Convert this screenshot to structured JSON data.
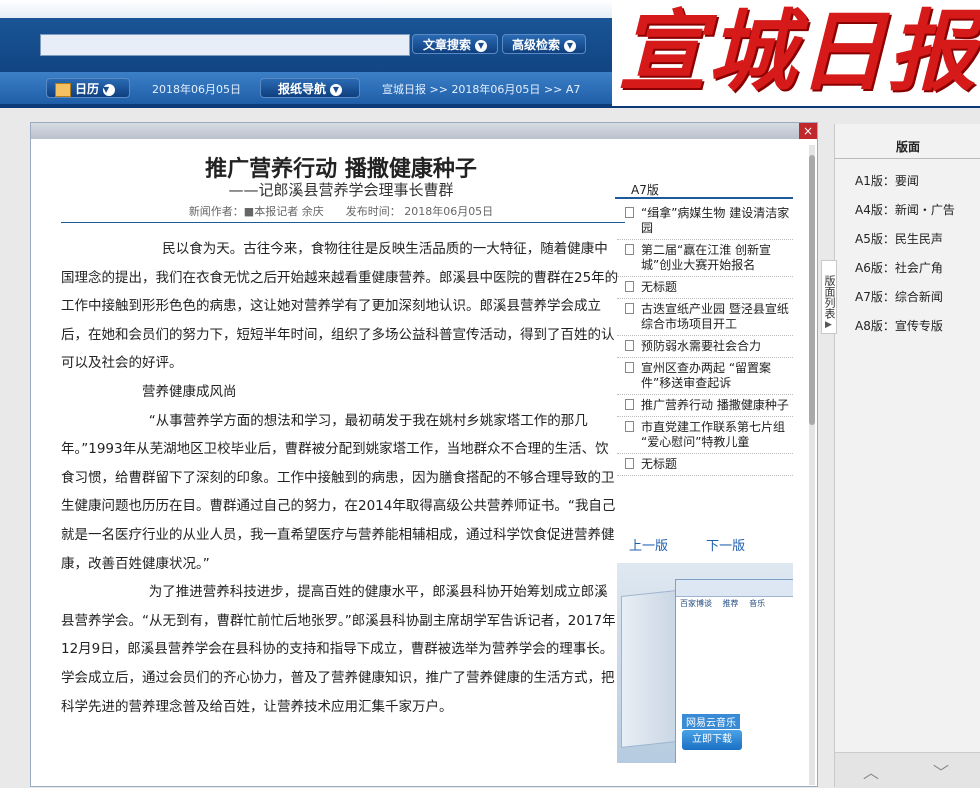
{
  "header": {
    "search_placeholder": "",
    "article_search": "文章搜索",
    "advanced_search": "高级检索",
    "logo_text": "宣城日报"
  },
  "nav": {
    "calendar": "日历",
    "date": "2018年06月05日",
    "paper_nav": "报纸导航",
    "breadcrumb": [
      "宣城日报",
      "2018年06月05日",
      "A7"
    ],
    "breadcrumb_sep": ">>"
  },
  "article": {
    "title": "推广营养行动 播撒健康种子",
    "subtitle": "——记郎溪县营养学会理事长曹群",
    "meta": "新闻作者：■本报记者 余庆　　发布时间： 2018年06月05日",
    "paragraphs": [
      "民以食为天。古往今来，食物往往是反映生活品质的一大特征，随着健康中国理念的提出，我们在衣食无忧之后开始越来越看重健康营养。郎溪县中医院的曹群在25年的工作中接触到形形色色的病患，这让她对营养学有了更加深刻地认识。郎溪县营养学会成立后，在她和会员们的努力下，短短半年时间，组织了多场公益科普宣传活动，得到了百姓的认可以及社会的好评。",
      "营养健康成风尚",
      "“从事营养学方面的想法和学习，最初萌发于我在姚村乡姚家塔工作的那几年。”1993年从芜湖地区卫校毕业后，曹群被分配到姚家塔工作，当地群众不合理的生活、饮食习惯，给曹群留下了深刻的印象。工作中接触到的病患，因为膳食搭配的不够合理导致的卫生健康问题也历历在目。曹群通过自己的努力，在2014年取得高级公共营养师证书。“我自己就是一名医疗行业的从业人员，我一直希望医疗与营养能相辅相成，通过科学饮食促进营养健康，改善百姓健康状况。”",
      "为了推进营养科技进步，提高百姓的健康水平，郎溪县科协开始筹划成立郎溪县营养学会。“从无到有，曹群忙前忙后地张罗。”郎溪县科协副主席胡学军告诉记者，2017年12月9日，郎溪县营养学会在县科协的支持和指导下成立，曹群被选举为营养学会的理事长。学会成立后，通过会员们的齐心协力，普及了营养健康知识，推广了营养健康的生活方式，把科学先进的营养理念普及给百姓，让营养技术应用汇集千家万户。"
    ]
  },
  "a7": {
    "heading": "A7版",
    "items": [
      "“缉拿”病媒生物 建设清洁家园",
      "第二届“赢在江淮 创新宣城”创业大赛开始报名",
      "无标题",
      "古迭宣纸产业园 暨泾县宣纸综合市场项目开工",
      "预防弱水需要社会合力",
      "宣州区查办两起 “留置案件”移送审查起诉",
      "推广营养行动 播撒健康种子",
      "市直党建工作联系第七片组 “爱心慰问”特教儿童",
      "无标题"
    ],
    "prev": "上一版",
    "next": "下一版"
  },
  "ad": {
    "tabs": [
      "百家博谈",
      "推荐",
      "音乐"
    ],
    "button": "立即下载",
    "brand": "网易云音乐"
  },
  "sidebar": {
    "heading": "版面",
    "tab_label": "版面列表",
    "items": [
      "A1版：要闻",
      "A4版：新闻・广告",
      "A5版：民生民声",
      "A6版：社会广角",
      "A7版：综合新闻",
      "A8版：宣传专版"
    ]
  }
}
